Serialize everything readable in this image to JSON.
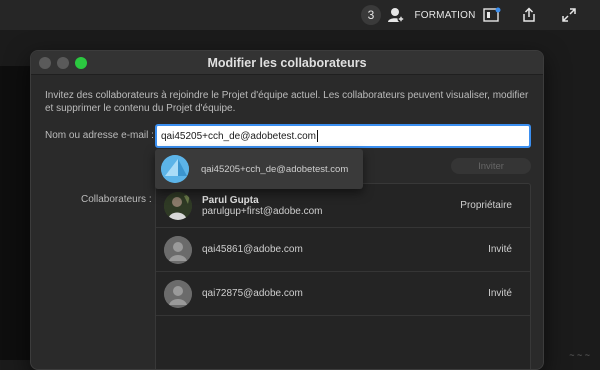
{
  "topbar": {
    "count": "3",
    "workspace": "FORMATION",
    "icons": [
      "add-collaborator-icon",
      "notification-icon",
      "share-icon",
      "fullscreen-icon"
    ]
  },
  "dialog": {
    "title": "Modifier les collaborateurs",
    "intro": "Invitez des collaborateurs à rejoindre le Projet d'équipe actuel. Les collaborateurs peuvent visualiser, modifier et supprimer le contenu du Projet d'équipe.",
    "email_label": "Nom ou adresse e-mail :",
    "email_value": "qai45205+cch_de@adobetest.com",
    "suggestion": "qai45205+cch_de@adobetest.com",
    "invite_label": "Inviter",
    "collaborators_label": "Collaborateurs :",
    "collaborators": [
      {
        "name": "Parul Gupta",
        "email": "parulgup+first@adobe.com",
        "role": "Propriétaire"
      },
      {
        "name": "",
        "email": "qai45861@adobe.com",
        "role": "Invité"
      },
      {
        "name": "",
        "email": "qai72875@adobe.com",
        "role": "Invité"
      }
    ]
  },
  "colors": {
    "accent": "#3b8ff0",
    "close_light": "#5a5a5a",
    "maximize_light": "#2bc840",
    "suggestion_avatar": "#5cb4e8"
  }
}
